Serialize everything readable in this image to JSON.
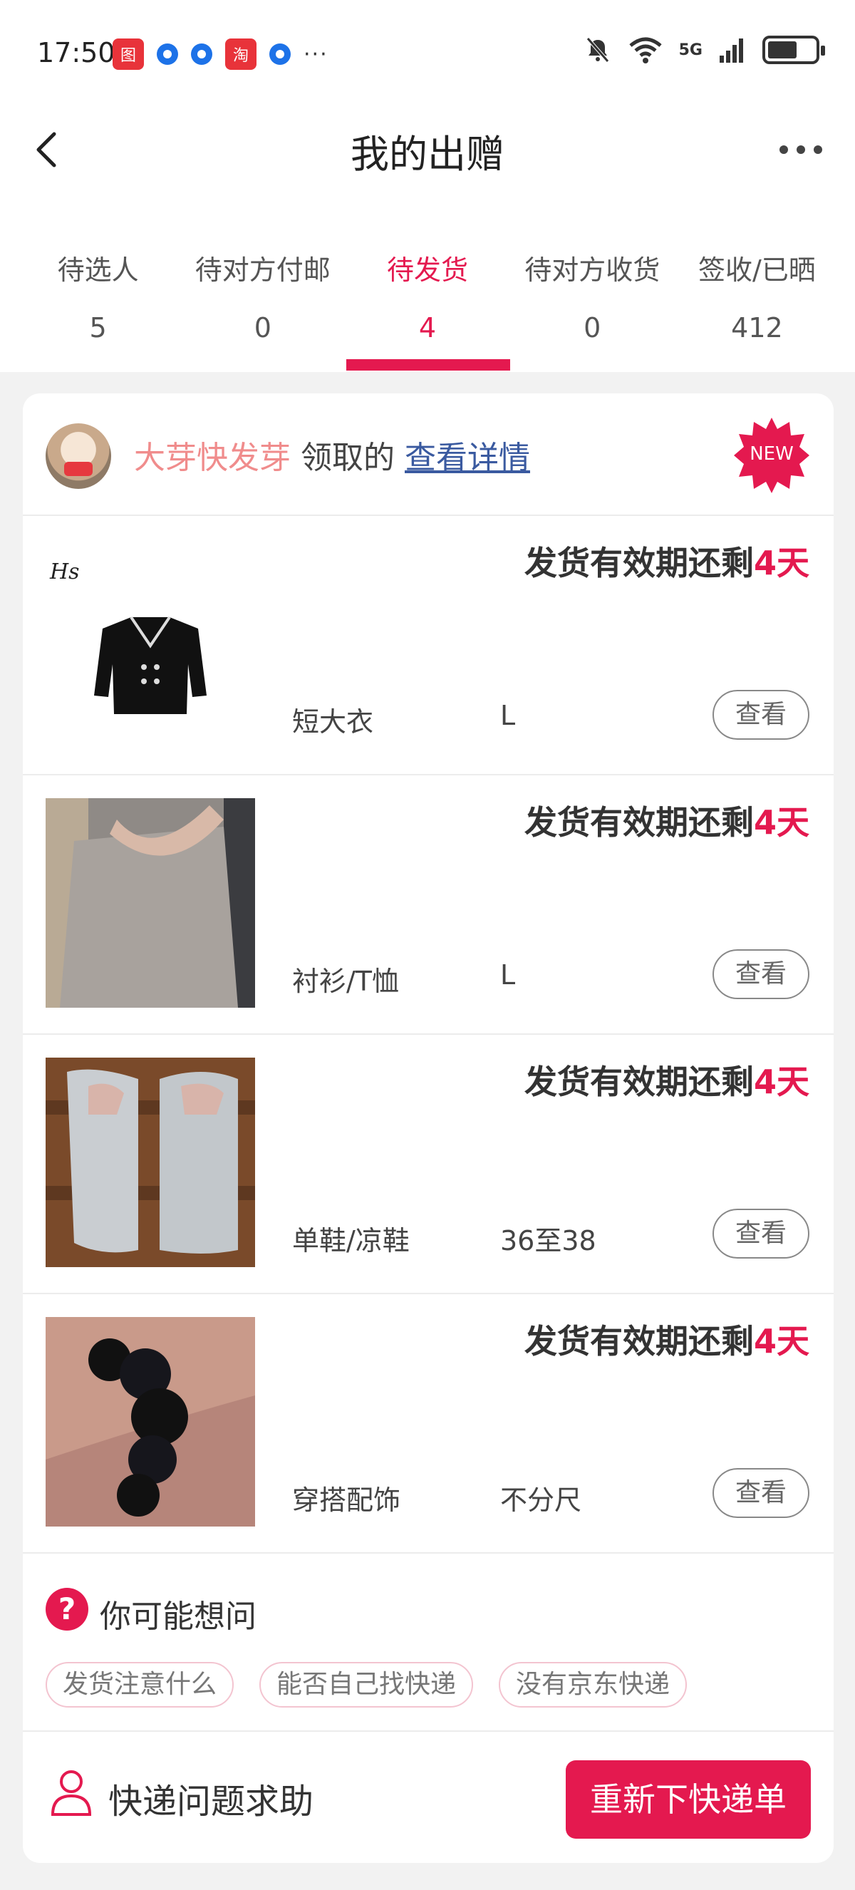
{
  "status_bar": {
    "time": "17:50",
    "more_indicator": "···",
    "network": "5G",
    "colors": {
      "app_badge": "#e8333a",
      "app_dot": "#1d72e8"
    }
  },
  "nav": {
    "title": "我的出赠",
    "back_icon": "chevron-left-icon",
    "more_icon": "more-dots-icon"
  },
  "tabs": [
    {
      "label": "待选人",
      "count": "5"
    },
    {
      "label": "待对方付邮",
      "count": "0"
    },
    {
      "label": "待发货",
      "count": "4",
      "active": true
    },
    {
      "label": "待对方收货",
      "count": "0"
    },
    {
      "label": "签收/已晒",
      "count": "412"
    }
  ],
  "card": {
    "giver_name": "大芽快发芽",
    "received_label": "领取的",
    "detail_link": "查看详情",
    "new_badge": "NEW"
  },
  "items": [
    {
      "deadline_prefix": "发货有效期还剩",
      "deadline_days": "4天",
      "category": "短大衣",
      "size": "L",
      "view_label": "查看"
    },
    {
      "deadline_prefix": "发货有效期还剩",
      "deadline_days": "4天",
      "category": "衬衫/T恤",
      "size": "L",
      "view_label": "查看"
    },
    {
      "deadline_prefix": "发货有效期还剩",
      "deadline_days": "4天",
      "category": "单鞋/凉鞋",
      "size": "36至38",
      "view_label": "查看"
    },
    {
      "deadline_prefix": "发货有效期还剩",
      "deadline_days": "4天",
      "category": "穿搭配饰",
      "size": "不分尺",
      "view_label": "查看"
    }
  ],
  "faq": {
    "icon_text": "?",
    "title": "你可能想问",
    "chips": [
      "发货注意什么",
      "能否自己找快递",
      "没有京东快递"
    ]
  },
  "footer": {
    "help_label": "快递问题求助",
    "reorder_button": "重新下快递单"
  },
  "colors": {
    "accent": "#e4194f",
    "giver_name": "#f08c8c",
    "link": "#3a5aa0"
  }
}
